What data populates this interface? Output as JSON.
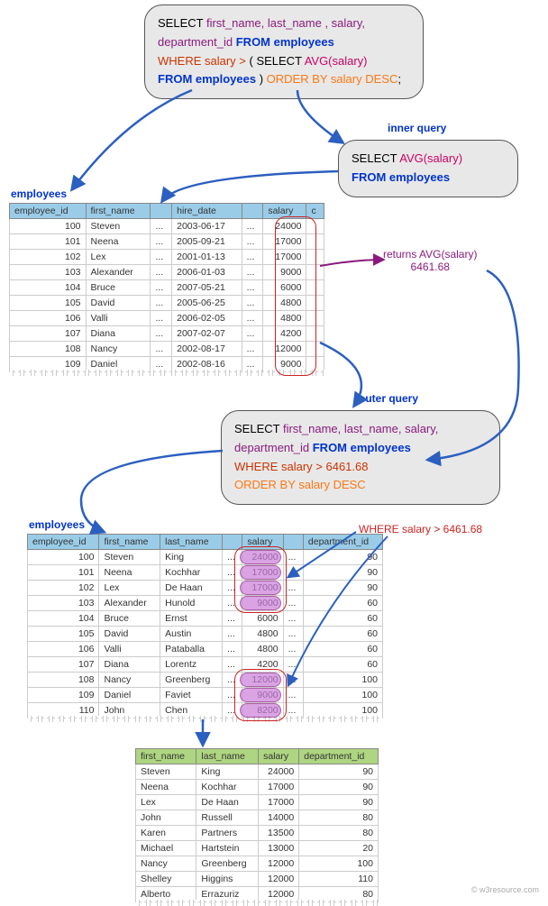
{
  "topQuery": {
    "line1a": "SELECT ",
    "line1b": "first_name, last_name , salary,",
    "line2a": "department_id   ",
    "line2b": "FROM employees",
    "line3a": "WHERE salary > ",
    "line3b": "( SELECT ",
    "line3c": "AVG(salary)",
    "line4a": "FROM employees ",
    "line4b": ") ",
    "line4c": "ORDER BY salary DESC",
    "line4d": ";"
  },
  "innerLabel": "inner query",
  "innerQuery": {
    "l1a": "SELECT ",
    "l1b": "AVG(salary)",
    "l2": "FROM employees"
  },
  "table1Label": "employees",
  "table1": {
    "headers": [
      "employee_id",
      "first_name",
      "",
      "hire_date",
      "",
      "salary",
      "c"
    ],
    "rows": [
      [
        "100",
        "Steven",
        "...",
        "2003-06-17",
        "...",
        "24000",
        ""
      ],
      [
        "101",
        "Neena",
        "...",
        "2005-09-21",
        "...",
        "17000",
        ""
      ],
      [
        "102",
        "Lex",
        "...",
        "2001-01-13",
        "...",
        "17000",
        ""
      ],
      [
        "103",
        "Alexander",
        "...",
        "2006-01-03",
        "...",
        "9000",
        ""
      ],
      [
        "104",
        "Bruce",
        "...",
        "2007-05-21",
        "...",
        "6000",
        ""
      ],
      [
        "105",
        "David",
        "...",
        "2005-06-25",
        "...",
        "4800",
        ""
      ],
      [
        "106",
        "Valli",
        "...",
        "2006-02-05",
        "...",
        "4800",
        ""
      ],
      [
        "107",
        "Diana",
        "...",
        "2007-02-07",
        "...",
        "4200",
        ""
      ],
      [
        "108",
        "Nancy",
        "...",
        "2002-08-17",
        "...",
        "12000",
        ""
      ],
      [
        "109",
        "Daniel",
        "...",
        "2002-08-16",
        "...",
        "9000",
        ""
      ]
    ]
  },
  "returnsLabel1": "returns AVG(salary)",
  "returnsLabel2": "6461.68",
  "outerLabel": "outer query",
  "outerQuery": {
    "l1a": "SELECT ",
    "l1b": "first_name, last_name, salary,",
    "l2a": "department_id  ",
    "l2b": "FROM employees",
    "l3": "WHERE salary > 6461.68",
    "l4": "ORDER BY salary DESC"
  },
  "table2Label": "employees",
  "whereLabel": "WHERE salary > 6461.68",
  "table2": {
    "headers": [
      "employee_id",
      "first_name",
      "last_name",
      "",
      "salary",
      "",
      "department_id"
    ],
    "rows": [
      [
        "100",
        "Steven",
        "King",
        "...",
        "24000",
        "...",
        "90"
      ],
      [
        "101",
        "Neena",
        "Kochhar",
        "...",
        "17000",
        "...",
        "90"
      ],
      [
        "102",
        "Lex",
        "De Haan",
        "...",
        "17000",
        "...",
        "90"
      ],
      [
        "103",
        "Alexander",
        "Hunold",
        "...",
        "9000",
        "...",
        "60"
      ],
      [
        "104",
        "Bruce",
        "Ernst",
        "...",
        "6000",
        "...",
        "60"
      ],
      [
        "105",
        "David",
        "Austin",
        "...",
        "4800",
        "...",
        "60"
      ],
      [
        "106",
        "Valli",
        "Pataballa",
        "...",
        "4800",
        "...",
        "60"
      ],
      [
        "107",
        "Diana",
        "Lorentz",
        "...",
        "4200",
        "...",
        "60"
      ],
      [
        "108",
        "Nancy",
        "Greenberg",
        "...",
        "12000",
        "...",
        "100"
      ],
      [
        "109",
        "Daniel",
        "Faviet",
        "...",
        "9000",
        "...",
        "100"
      ],
      [
        "110",
        "John",
        "Chen",
        "...",
        "8200",
        "...",
        "100"
      ]
    ]
  },
  "resultTable": {
    "headers": [
      "first_name",
      "last_name",
      "salary",
      "department_id"
    ],
    "rows": [
      [
        "Steven",
        "King",
        "24000",
        "90"
      ],
      [
        "Neena",
        "Kochhar",
        "17000",
        "90"
      ],
      [
        "Lex",
        "De Haan",
        "17000",
        "90"
      ],
      [
        "John",
        "Russell",
        "14000",
        "80"
      ],
      [
        "Karen",
        "Partners",
        "13500",
        "80"
      ],
      [
        "Michael",
        "Hartstein",
        "13000",
        "20"
      ],
      [
        "Nancy",
        "Greenberg",
        "12000",
        "100"
      ],
      [
        "Shelley",
        "Higgins",
        "12000",
        "110"
      ],
      [
        "Alberto",
        "Errazuriz",
        "12000",
        "80"
      ]
    ]
  },
  "footer": "© w3resource.com"
}
